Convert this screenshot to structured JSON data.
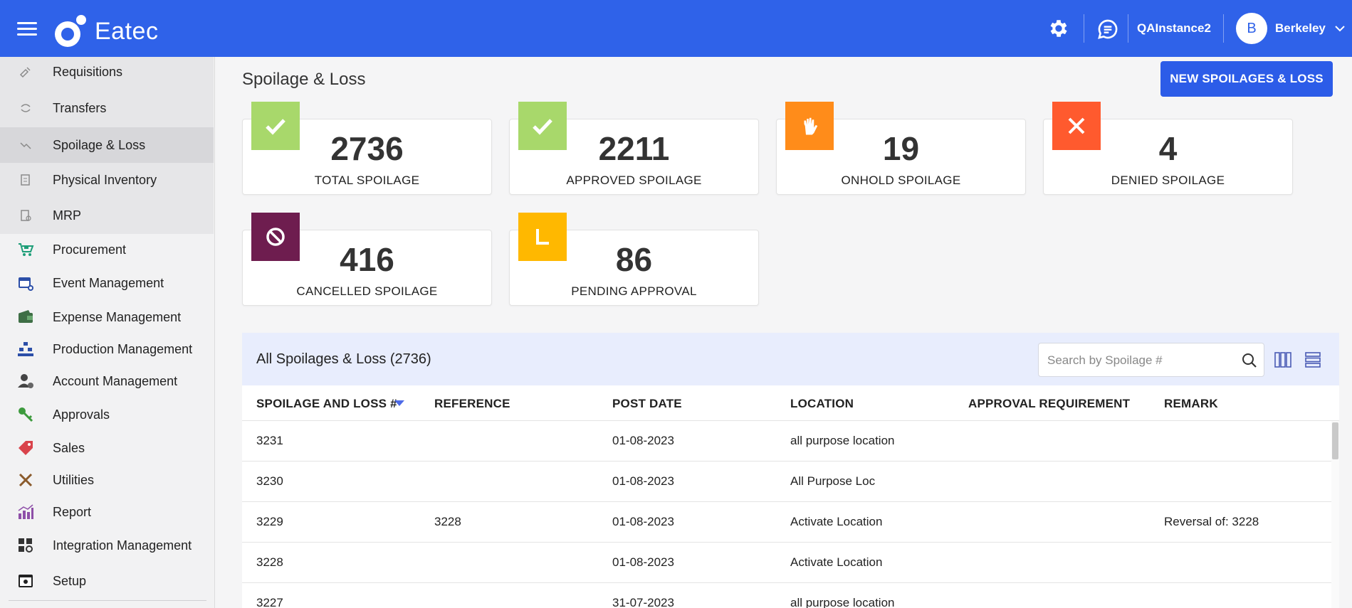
{
  "app": {
    "name": "Eatec",
    "instance": "QAInstance2",
    "user": {
      "initial": "B",
      "name": "Berkeley"
    }
  },
  "sidebar": {
    "items": [
      {
        "label": "Requisitions",
        "icon": "requisition-icon",
        "sub": true
      },
      {
        "label": "Transfers",
        "icon": "transfer-icon",
        "sub": true
      },
      {
        "label": "Spoilage & Loss",
        "icon": "spoilage-icon",
        "sub": true,
        "active": true
      },
      {
        "label": "Physical Inventory",
        "icon": "inventory-icon",
        "sub": true
      },
      {
        "label": "MRP",
        "icon": "mrp-icon",
        "sub": true
      },
      {
        "label": "Procurement",
        "icon": "cart-icon"
      },
      {
        "label": "Event Management",
        "icon": "calendar-icon"
      },
      {
        "label": "Expense Management",
        "icon": "wallet-icon"
      },
      {
        "label": "Production Management",
        "icon": "production-icon"
      },
      {
        "label": "Account Management",
        "icon": "account-icon"
      },
      {
        "label": "Approvals",
        "icon": "key-icon"
      },
      {
        "label": "Sales",
        "icon": "tag-icon"
      },
      {
        "label": "Utilities",
        "icon": "tools-icon"
      },
      {
        "label": "Report",
        "icon": "report-icon"
      },
      {
        "label": "Integration Management",
        "icon": "integration-icon"
      },
      {
        "label": "Setup",
        "icon": "setup-icon"
      }
    ]
  },
  "page": {
    "title": "Spoilage & Loss",
    "new_button": "NEW SPOILAGES & LOSS"
  },
  "cards": [
    {
      "count": "2736",
      "label": "TOTAL SPOILAGE",
      "icon": "check-icon",
      "color": "#a8d86b"
    },
    {
      "count": "2211",
      "label": "APPROVED SPOILAGE",
      "icon": "check-icon",
      "color": "#a8d86b"
    },
    {
      "count": "19",
      "label": "ONHOLD SPOILAGE",
      "icon": "hand-icon",
      "color": "#ff8c1a"
    },
    {
      "count": "4",
      "label": "DENIED SPOILAGE",
      "icon": "x-icon",
      "color": "#ff5a2e"
    },
    {
      "count": "416",
      "label": "CANCELLED SPOILAGE",
      "icon": "ban-icon",
      "color": "#6e1d4f"
    },
    {
      "count": "86",
      "label": "PENDING APPROVAL",
      "icon": "pending-icon",
      "color": "#ffb800"
    }
  ],
  "table": {
    "title": "All Spoilages & Loss (2736)",
    "search_placeholder": "Search by Spoilage #",
    "columns": [
      "SPOILAGE AND LOSS #",
      "REFERENCE",
      "POST DATE",
      "LOCATION",
      "APPROVAL REQUIREMENT",
      "REMARK"
    ],
    "rows": [
      [
        "3231",
        "",
        "01-08-2023",
        "all purpose location",
        "",
        ""
      ],
      [
        "3230",
        "",
        "01-08-2023",
        "All Purpose Loc",
        "",
        ""
      ],
      [
        "3229",
        "3228",
        "01-08-2023",
        "Activate Location",
        "",
        "Reversal of: 3228"
      ],
      [
        "3228",
        "",
        "01-08-2023",
        "Activate Location",
        "",
        ""
      ],
      [
        "3227",
        "",
        "31-07-2023",
        "all purpose location",
        "",
        ""
      ]
    ]
  }
}
